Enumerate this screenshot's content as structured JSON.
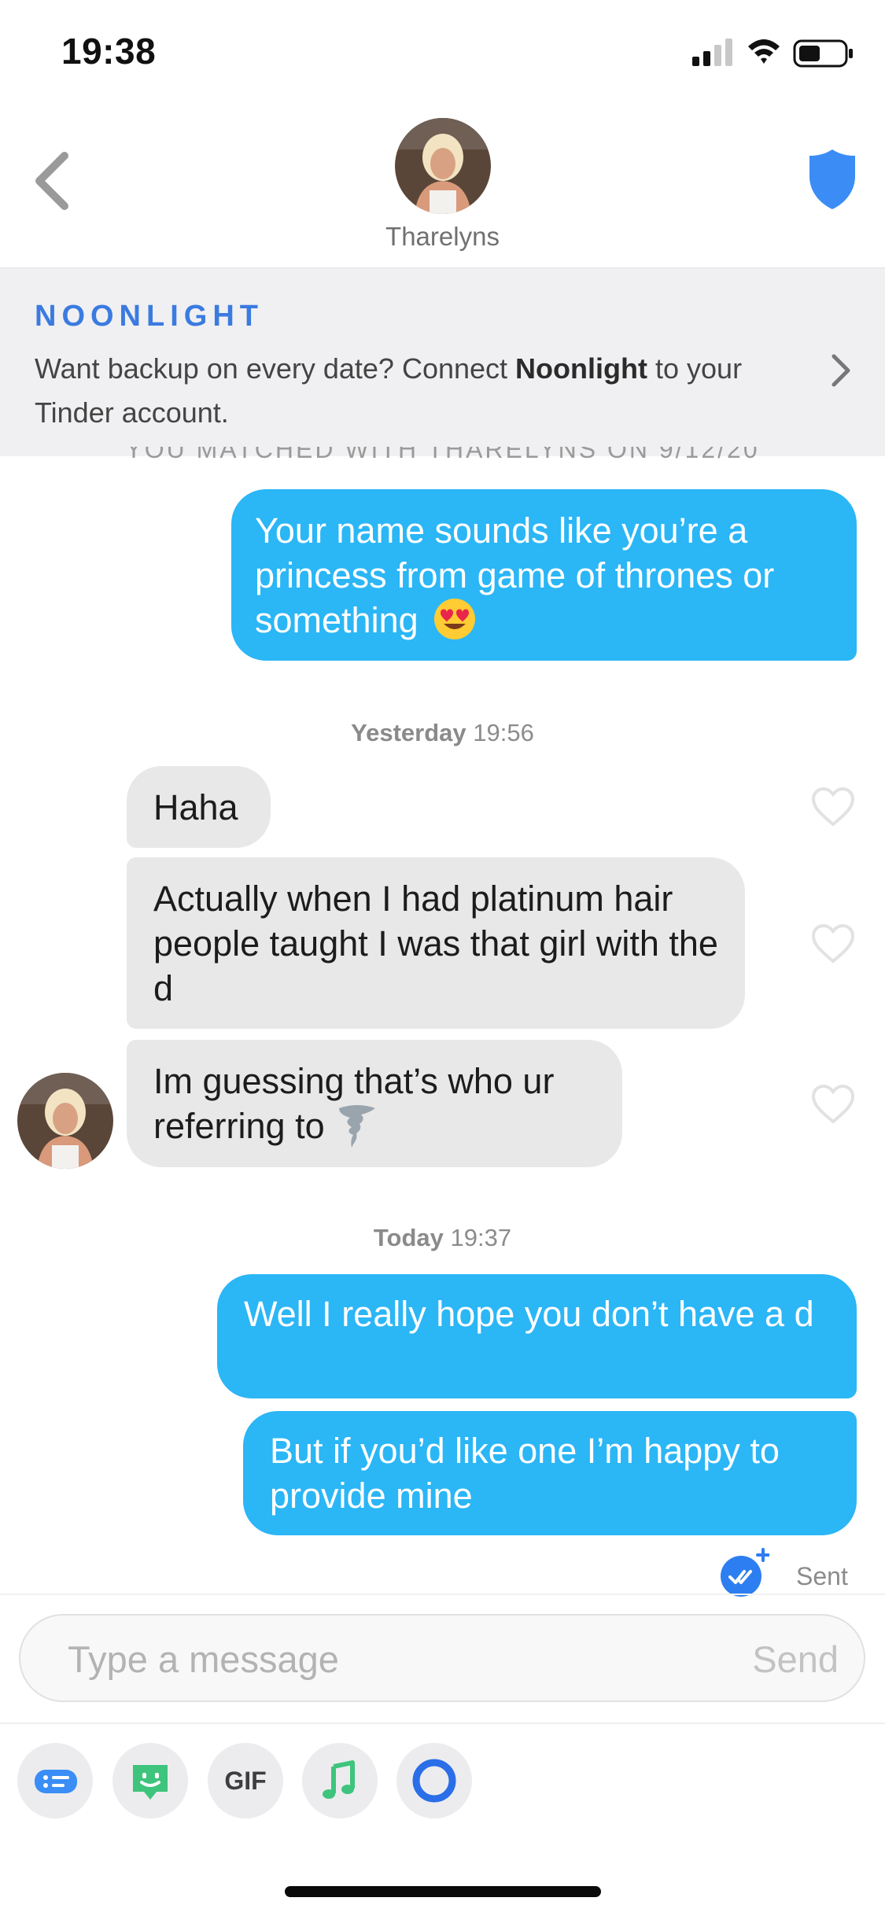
{
  "status_bar": {
    "time": "19:38"
  },
  "header": {
    "name": "Tharelyns"
  },
  "banner": {
    "brand": "NOONLIGHT",
    "text_before": "Want backup on every date? Connect ",
    "text_bold": "Noonlight",
    "text_after": " to your Tinder account."
  },
  "matched_notice": "YOU MATCHED WITH THARELYNS ON 9/12/20",
  "messages": [
    {
      "side": "out",
      "text": "Your name sounds like you’re a princess from game of thrones or something",
      "emoji": "heart-eyes"
    },
    {
      "side": "in",
      "text": "Haha"
    },
    {
      "side": "in",
      "text": "Actually when I had platinum hair people taught I was that girl with the d"
    },
    {
      "side": "in",
      "text": "Im guessing that’s who ur referring to",
      "emoji": "tornado"
    },
    {
      "side": "out",
      "text": "Well I really hope you don’t have a d"
    },
    {
      "side": "out",
      "text": "But if you’d like one I’m happy to provide mine"
    }
  ],
  "timestamps": [
    {
      "day": "Yesterday",
      "time": "19:56"
    },
    {
      "day": "Today",
      "time": "19:37"
    }
  ],
  "status": {
    "sent_label": "Sent"
  },
  "composer": {
    "placeholder": "Type a message",
    "send_label": "Send"
  },
  "toolbar": {
    "gif_label": "GIF"
  },
  "colors": {
    "outgoing_bubble": "#2bb6f6",
    "incoming_bubble": "#e8e8e8",
    "accent_blue": "#3b7be0",
    "sticker_green": "#3ec47c"
  },
  "icons": [
    "back-chevron-icon",
    "shield-icon",
    "heart-icon",
    "read-receipt-icon",
    "quick-reply-icon",
    "sticker-icon",
    "music-icon",
    "noonlight-ring-icon"
  ]
}
